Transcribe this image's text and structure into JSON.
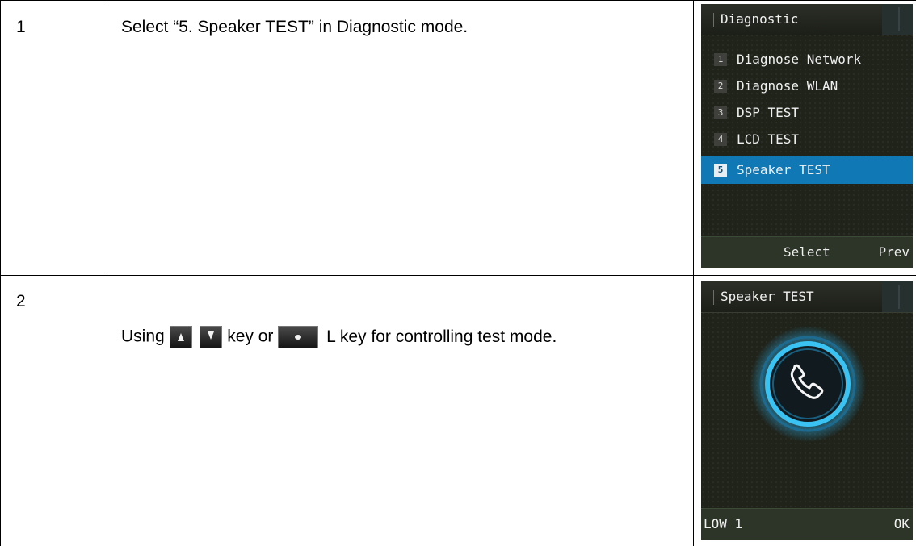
{
  "rows": [
    {
      "number": "1",
      "instruction": "Select “5. Speaker TEST” in Diagnostic mode.",
      "screen": {
        "title": "Diagnostic",
        "menu": [
          {
            "num": "1",
            "label": "Diagnose Network",
            "selected": false
          },
          {
            "num": "2",
            "label": "Diagnose WLAN",
            "selected": false
          },
          {
            "num": "3",
            "label": "DSP TEST",
            "selected": false
          },
          {
            "num": "4",
            "label": "LCD TEST",
            "selected": false
          },
          {
            "num": "5",
            "label": "Speaker TEST",
            "selected": true
          }
        ],
        "softkeys": {
          "center": "Select",
          "right": "Prev"
        }
      }
    },
    {
      "number": "2",
      "instruction": {
        "prefix": "Using",
        "keys_up_down": [
          "up-arrow-key-icon",
          "down-arrow-key-icon"
        ],
        "middle": "key or",
        "key_center": "ok-key-icon",
        "suffix": "L key for controlling test mode."
      },
      "screen": {
        "title": "Speaker TEST",
        "icon": "phone-call-icon",
        "softkeys": {
          "left": "LOW 1",
          "right": "OK"
        }
      }
    }
  ],
  "colors": {
    "selection": "#0f78b5",
    "screen_bg": "#1f231a",
    "ring": "#2aa8e0"
  }
}
